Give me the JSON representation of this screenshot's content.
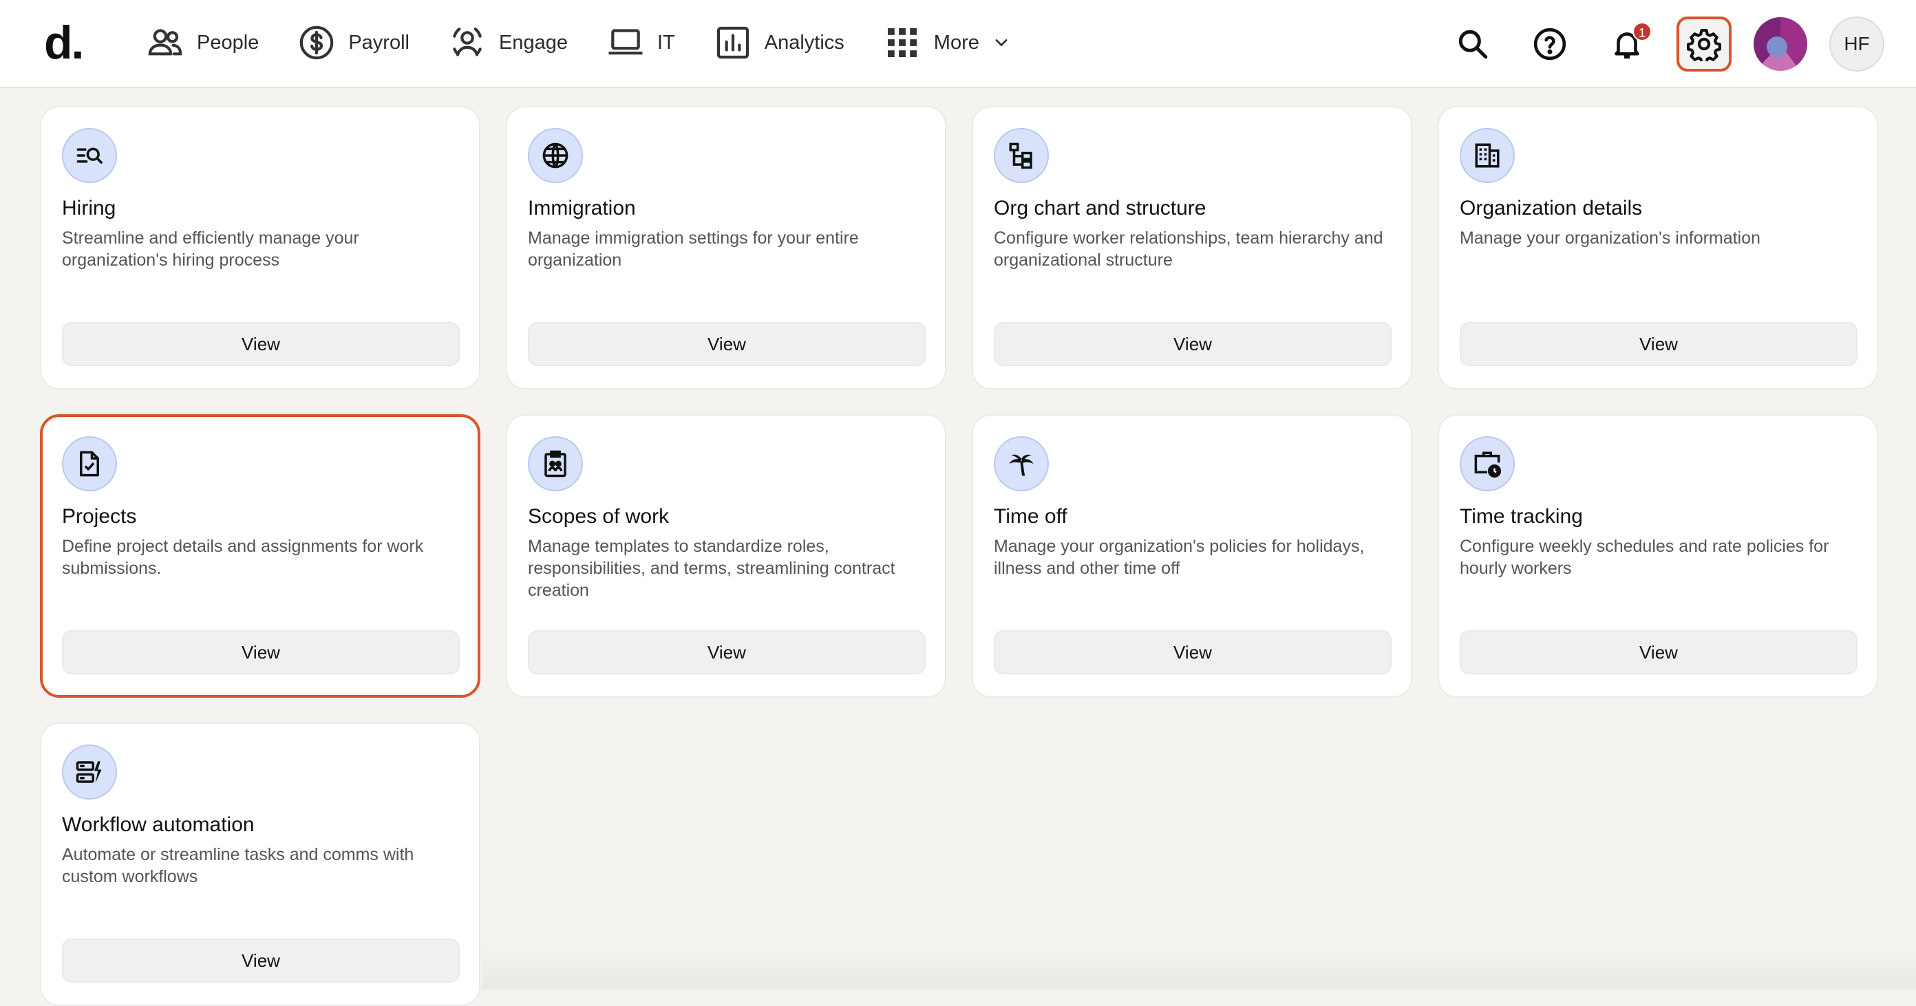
{
  "brand": {
    "logo_text": "d."
  },
  "nav": {
    "items": [
      {
        "label": "People",
        "icon": "people-icon"
      },
      {
        "label": "Payroll",
        "icon": "dollar-circle-icon"
      },
      {
        "label": "Engage",
        "icon": "engage-icon"
      },
      {
        "label": "IT",
        "icon": "laptop-icon"
      },
      {
        "label": "Analytics",
        "icon": "bar-chart-icon"
      },
      {
        "label": "More",
        "icon": "grid-icon"
      }
    ]
  },
  "toolbar": {
    "notification_count": "1",
    "user_initials": "HF"
  },
  "cards": [
    {
      "title": "Hiring",
      "description": "Streamline and efficiently manage your organization's hiring process",
      "button": "View",
      "icon": "hiring-search-icon"
    },
    {
      "title": "Immigration",
      "description": "Manage immigration settings for your entire organization",
      "button": "View",
      "icon": "globe-icon"
    },
    {
      "title": "Org chart and structure",
      "description": "Configure worker relationships, team hierarchy and organizational structure",
      "button": "View",
      "icon": "org-chart-icon"
    },
    {
      "title": "Organization details",
      "description": "Manage your organization's information",
      "button": "View",
      "icon": "building-icon"
    },
    {
      "title": "Projects",
      "description": "Define project details and assignments for work submissions.",
      "button": "View",
      "icon": "document-check-icon"
    },
    {
      "title": "Scopes of work",
      "description": "Manage templates to standardize roles, responsibilities, and terms, streamlining contract creation",
      "button": "View",
      "icon": "clipboard-people-icon"
    },
    {
      "title": "Time off",
      "description": "Manage your organization's policies for holidays, illness and other time off",
      "button": "View",
      "icon": "palm-tree-icon"
    },
    {
      "title": "Time tracking",
      "description": "Configure weekly schedules and rate policies for hourly workers",
      "button": "View",
      "icon": "briefcase-clock-icon"
    },
    {
      "title": "Workflow automation",
      "description": "Automate or streamline tasks and comms with custom workflows",
      "button": "View",
      "icon": "workflow-bolt-icon"
    }
  ],
  "colors": {
    "accent_selected": "#d8552b",
    "icon_bg": "#d8e3fb",
    "page_bg": "#f4f3f0",
    "badge": "#c6352c"
  }
}
